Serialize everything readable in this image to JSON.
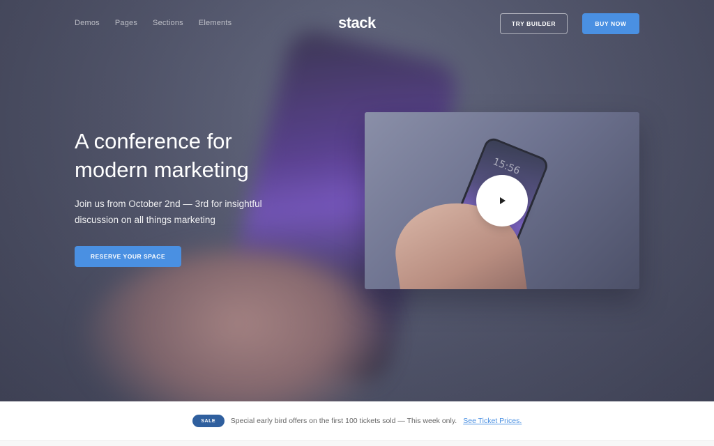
{
  "header": {
    "nav": [
      "Demos",
      "Pages",
      "Sections",
      "Elements"
    ],
    "logo": "stack",
    "try_builder_label": "TRY BUILDER",
    "buy_now_label": "BUY NOW"
  },
  "hero": {
    "headline": "A conference for modern marketing",
    "subheading": "Join us from October 2nd — 3rd for insightful discussion on all things marketing",
    "cta_label": "RESERVE YOUR SPACE",
    "video": {
      "phone_time": "15:56",
      "play_icon": "play-icon"
    }
  },
  "notice": {
    "badge": "SALE",
    "text": "Special early bird offers on the first 100 tickets sold — This week only.",
    "link": "See Ticket Prices."
  },
  "colors": {
    "accent": "#4a90e2",
    "badge": "#2f5f9e"
  }
}
